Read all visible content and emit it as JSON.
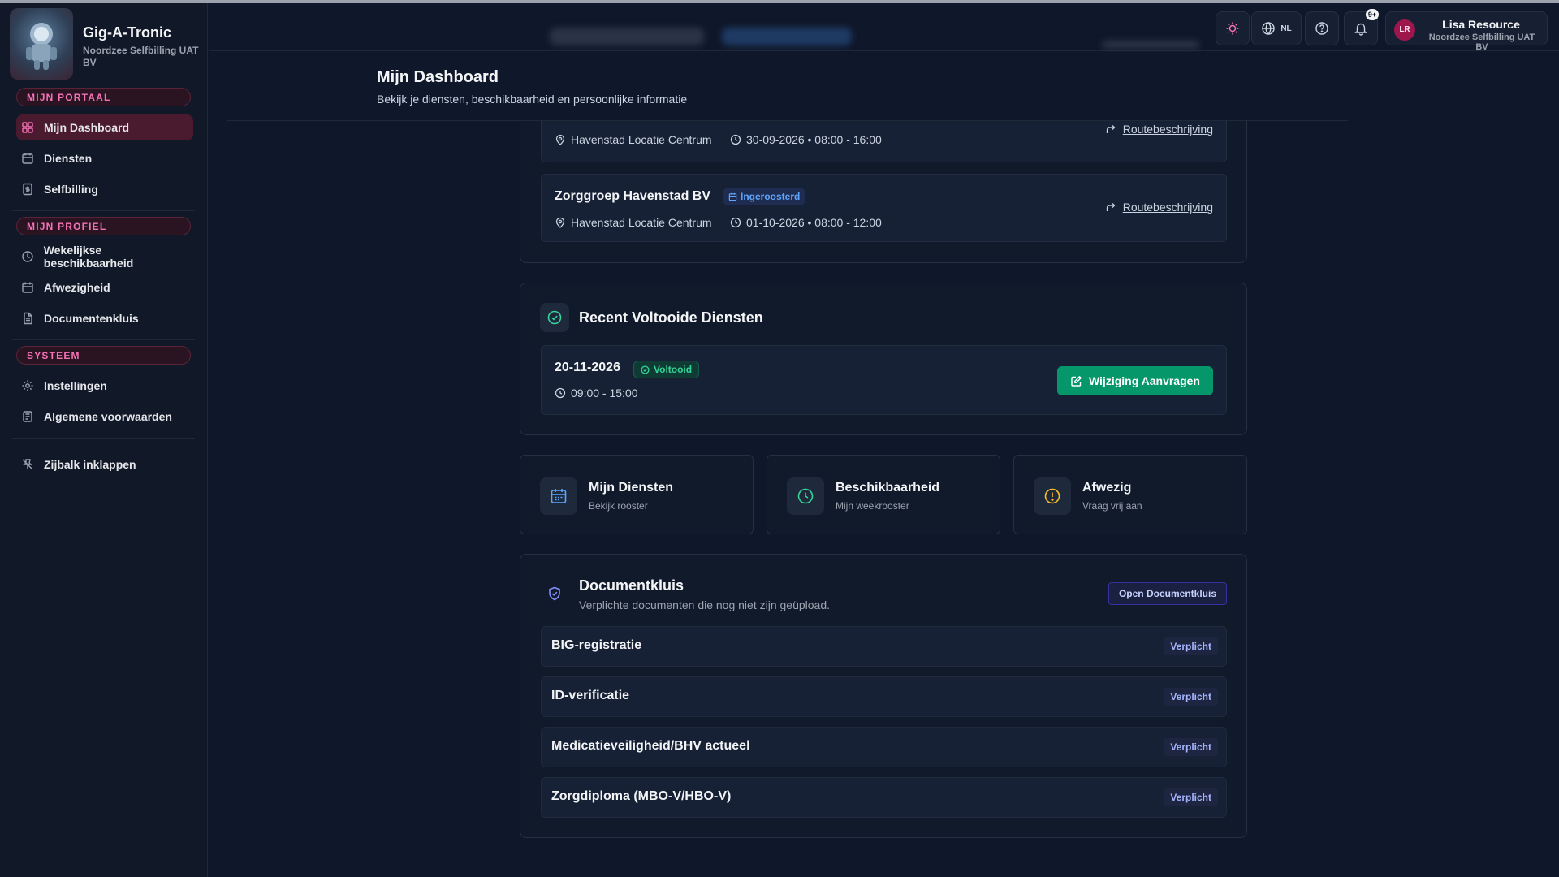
{
  "brand": {
    "name": "Gig-A-Tronic",
    "org": "Noordzee Selfbilling UAT BV"
  },
  "sidebar": {
    "sections": [
      {
        "label": "MIJN PORTAAL",
        "items": [
          "Mijn Dashboard",
          "Diensten",
          "Selfbilling"
        ]
      },
      {
        "label": "MIJN PROFIEL",
        "items": [
          "Wekelijkse beschikbaarheid",
          "Afwezigheid",
          "Documentenkluis"
        ]
      },
      {
        "label": "SYSTEEM",
        "items": [
          "Instellingen",
          "Algemene voorwaarden"
        ]
      }
    ],
    "collapse_label": "Zijbalk inklappen"
  },
  "topbar": {
    "language": "NL",
    "notifications_badge": "9+",
    "user": {
      "initials": "LR",
      "name": "Lisa Resource",
      "org": "Noordzee Selfbilling UAT BV"
    }
  },
  "page": {
    "title": "Mijn Dashboard",
    "subtitle": "Bekijk je diensten, beschikbaarheid en persoonlijke informatie"
  },
  "upcoming_shifts": [
    {
      "location": "Havenstad Locatie Centrum",
      "datetime": "30-09-2026 • 08:00 - 16:00",
      "route_label": "Routebeschrijving"
    },
    {
      "org": "Zorggroep Havenstad BV",
      "status": "Ingeroosterd",
      "location": "Havenstad Locatie Centrum",
      "datetime": "01-10-2026 • 08:00 - 12:00",
      "route_label": "Routebeschrijving"
    }
  ],
  "completed": {
    "title": "Recent Voltooide Diensten",
    "items": [
      {
        "date": "20-11-2026",
        "status": "Voltooid",
        "time": "09:00 - 15:00",
        "action_label": "Wijziging Aanvragen"
      }
    ]
  },
  "quick_links": [
    {
      "title": "Mijn Diensten",
      "subtitle": "Bekijk rooster",
      "icon": "calendar-icon",
      "color": "#60a5fa"
    },
    {
      "title": "Beschikbaarheid",
      "subtitle": "Mijn weekrooster",
      "icon": "clock-icon",
      "color": "#34d399"
    },
    {
      "title": "Afwezig",
      "subtitle": "Vraag vrij aan",
      "icon": "alert-circle-icon",
      "color": "#fbbf24"
    }
  ],
  "documents": {
    "title": "Documentkluis",
    "subtitle": "Verplichte documenten die nog niet zijn geüpload.",
    "open_label": "Open Documentkluis",
    "items": [
      {
        "name": "BIG-registratie",
        "badge": "Verplicht"
      },
      {
        "name": "ID-verificatie",
        "badge": "Verplicht"
      },
      {
        "name": "Medicatieveiligheid/BHV actueel",
        "badge": "Verplicht"
      },
      {
        "name": "Zorgdiploma (MBO-V/HBO-V)",
        "badge": "Verplicht"
      }
    ]
  },
  "colors": {
    "accent": "#f472b6",
    "success": "#059669",
    "info": "#60a5fa",
    "background": "#0f172a"
  }
}
